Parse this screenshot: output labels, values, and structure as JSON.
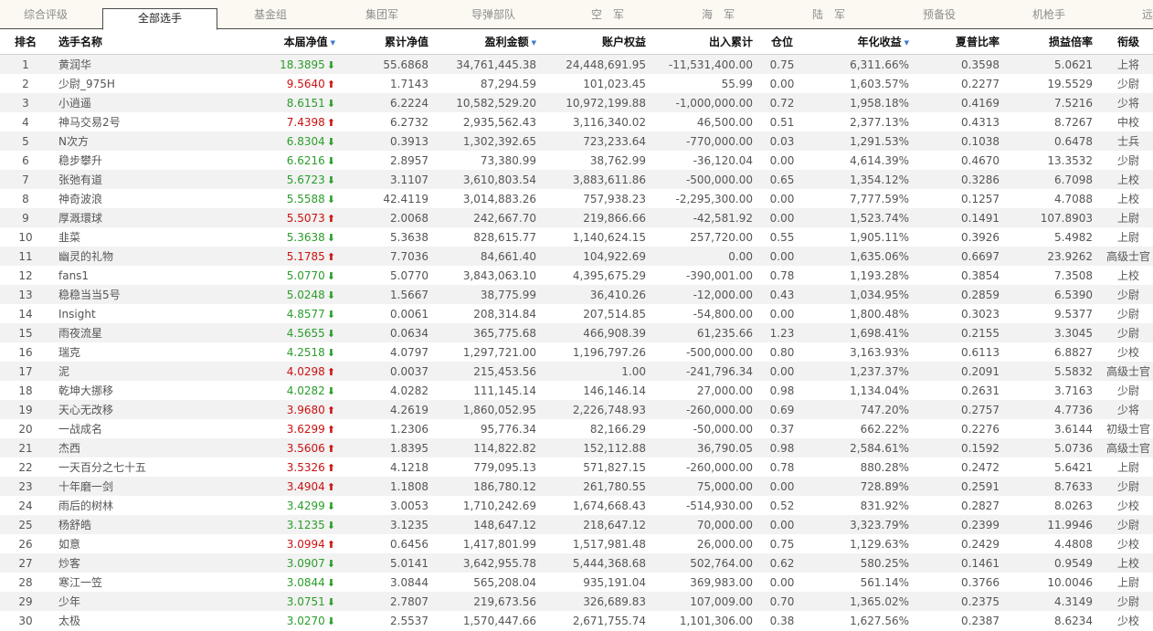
{
  "tabs": [
    "综合评级",
    "全部选手",
    "基金组",
    "集团军",
    "导弹部队",
    "空　军",
    "海　军",
    "陆　军",
    "预备役",
    "机枪手",
    "远"
  ],
  "active_tab": 1,
  "columns": [
    "排名",
    "选手名称",
    "本届净值",
    "累计净值",
    "盈利金额",
    "账户权益",
    "出入累计",
    "仓位",
    "年化收益",
    "夏普比率",
    "损益倍率",
    "衔级"
  ],
  "sorted_columns": [
    "本届净值",
    "盈利金额",
    "年化收益"
  ],
  "colors": {
    "up": "#cc1111",
    "down": "#2a9d2a",
    "sort_indicator": "#3a78c9"
  },
  "rows": [
    {
      "rank": "1",
      "name": "黄润华",
      "nav": "18.3895",
      "trend": "down",
      "cum": "55.6868",
      "profit": "34,761,445.38",
      "equity": "24,448,691.95",
      "flow": "-11,531,400.00",
      "pos": "0.75",
      "annual": "6,311.66%",
      "sharpe": "0.3598",
      "ratio": "5.0621",
      "title": "上将"
    },
    {
      "rank": "2",
      "name": "少尉_975H",
      "nav": "9.5640",
      "trend": "up",
      "cum": "1.7143",
      "profit": "87,294.59",
      "equity": "101,023.45",
      "flow": "55.99",
      "pos": "0.00",
      "annual": "1,603.57%",
      "sharpe": "0.2277",
      "ratio": "19.5529",
      "title": "少尉"
    },
    {
      "rank": "3",
      "name": "小逍遥",
      "nav": "8.6151",
      "trend": "down",
      "cum": "6.2224",
      "profit": "10,582,529.20",
      "equity": "10,972,199.88",
      "flow": "-1,000,000.00",
      "pos": "0.72",
      "annual": "1,958.18%",
      "sharpe": "0.4169",
      "ratio": "7.5216",
      "title": "少将"
    },
    {
      "rank": "4",
      "name": "神马交易2号",
      "nav": "7.4398",
      "trend": "up",
      "cum": "6.2732",
      "profit": "2,935,562.43",
      "equity": "3,116,340.02",
      "flow": "46,500.00",
      "pos": "0.51",
      "annual": "2,377.13%",
      "sharpe": "0.4313",
      "ratio": "8.7267",
      "title": "中校"
    },
    {
      "rank": "5",
      "name": "N次方",
      "nav": "6.8304",
      "trend": "down",
      "cum": "0.3913",
      "profit": "1,302,392.65",
      "equity": "723,233.64",
      "flow": "-770,000.00",
      "pos": "0.03",
      "annual": "1,291.53%",
      "sharpe": "0.1038",
      "ratio": "0.6478",
      "title": "士兵"
    },
    {
      "rank": "6",
      "name": "稳步攀升",
      "nav": "6.6216",
      "trend": "down",
      "cum": "2.8957",
      "profit": "73,380.99",
      "equity": "38,762.99",
      "flow": "-36,120.04",
      "pos": "0.00",
      "annual": "4,614.39%",
      "sharpe": "0.4670",
      "ratio": "13.3532",
      "title": "少尉"
    },
    {
      "rank": "7",
      "name": "张弛有道",
      "nav": "5.6723",
      "trend": "down",
      "cum": "3.1107",
      "profit": "3,610,803.54",
      "equity": "3,883,611.86",
      "flow": "-500,000.00",
      "pos": "0.65",
      "annual": "1,354.12%",
      "sharpe": "0.3286",
      "ratio": "6.7098",
      "title": "上校"
    },
    {
      "rank": "8",
      "name": "神奇波浪",
      "nav": "5.5588",
      "trend": "down",
      "cum": "42.4119",
      "profit": "3,014,883.26",
      "equity": "757,938.23",
      "flow": "-2,295,300.00",
      "pos": "0.00",
      "annual": "7,777.59%",
      "sharpe": "0.1257",
      "ratio": "4.7088",
      "title": "上校"
    },
    {
      "rank": "9",
      "name": "厚溉環球",
      "nav": "5.5073",
      "trend": "up",
      "cum": "2.0068",
      "profit": "242,667.70",
      "equity": "219,866.66",
      "flow": "-42,581.92",
      "pos": "0.00",
      "annual": "1,523.74%",
      "sharpe": "0.1491",
      "ratio": "107.8903",
      "title": "上尉"
    },
    {
      "rank": "10",
      "name": "韭菜",
      "nav": "5.3638",
      "trend": "down",
      "cum": "5.3638",
      "profit": "828,615.77",
      "equity": "1,140,624.15",
      "flow": "257,720.00",
      "pos": "0.55",
      "annual": "1,905.11%",
      "sharpe": "0.3926",
      "ratio": "5.4982",
      "title": "上尉"
    },
    {
      "rank": "11",
      "name": "幽灵的礼物",
      "nav": "5.1785",
      "trend": "up",
      "cum": "7.7036",
      "profit": "84,661.40",
      "equity": "104,922.69",
      "flow": "0.00",
      "pos": "0.00",
      "annual": "1,635.06%",
      "sharpe": "0.6697",
      "ratio": "23.9262",
      "title": "高级士官"
    },
    {
      "rank": "12",
      "name": "fans1",
      "nav": "5.0770",
      "trend": "down",
      "cum": "5.0770",
      "profit": "3,843,063.10",
      "equity": "4,395,675.29",
      "flow": "-390,001.00",
      "pos": "0.78",
      "annual": "1,193.28%",
      "sharpe": "0.3854",
      "ratio": "7.3508",
      "title": "上校"
    },
    {
      "rank": "13",
      "name": "稳稳当当5号",
      "nav": "5.0248",
      "trend": "down",
      "cum": "1.5667",
      "profit": "38,775.99",
      "equity": "36,410.26",
      "flow": "-12,000.00",
      "pos": "0.43",
      "annual": "1,034.95%",
      "sharpe": "0.2859",
      "ratio": "6.5390",
      "title": "少尉"
    },
    {
      "rank": "14",
      "name": "Insight",
      "nav": "4.8577",
      "trend": "down",
      "cum": "0.0061",
      "profit": "208,314.84",
      "equity": "207,514.85",
      "flow": "-54,800.00",
      "pos": "0.00",
      "annual": "1,800.48%",
      "sharpe": "0.3023",
      "ratio": "9.5377",
      "title": "少尉"
    },
    {
      "rank": "15",
      "name": "雨夜流星",
      "nav": "4.5655",
      "trend": "down",
      "cum": "0.0634",
      "profit": "365,775.68",
      "equity": "466,908.39",
      "flow": "61,235.66",
      "pos": "1.23",
      "annual": "1,698.41%",
      "sharpe": "0.2155",
      "ratio": "3.3045",
      "title": "少尉"
    },
    {
      "rank": "16",
      "name": "瑞克",
      "nav": "4.2518",
      "trend": "down",
      "cum": "4.0797",
      "profit": "1,297,721.00",
      "equity": "1,196,797.26",
      "flow": "-500,000.00",
      "pos": "0.80",
      "annual": "3,163.93%",
      "sharpe": "0.6113",
      "ratio": "6.8827",
      "title": "少校"
    },
    {
      "rank": "17",
      "name": "泥",
      "nav": "4.0298",
      "trend": "up",
      "cum": "0.0037",
      "profit": "215,453.56",
      "equity": "1.00",
      "flow": "-241,796.34",
      "pos": "0.00",
      "annual": "1,237.37%",
      "sharpe": "0.2091",
      "ratio": "5.5832",
      "title": "高级士官"
    },
    {
      "rank": "18",
      "name": "乾坤大挪移",
      "nav": "4.0282",
      "trend": "down",
      "cum": "4.0282",
      "profit": "111,145.14",
      "equity": "146,146.14",
      "flow": "27,000.00",
      "pos": "0.98",
      "annual": "1,134.04%",
      "sharpe": "0.2631",
      "ratio": "3.7163",
      "title": "少尉"
    },
    {
      "rank": "19",
      "name": "天心无改移",
      "nav": "3.9680",
      "trend": "up",
      "cum": "4.2619",
      "profit": "1,860,052.95",
      "equity": "2,226,748.93",
      "flow": "-260,000.00",
      "pos": "0.69",
      "annual": "747.20%",
      "sharpe": "0.2757",
      "ratio": "4.7736",
      "title": "少将"
    },
    {
      "rank": "20",
      "name": "一战成名",
      "nav": "3.6299",
      "trend": "up",
      "cum": "1.2306",
      "profit": "95,776.34",
      "equity": "82,166.29",
      "flow": "-50,000.00",
      "pos": "0.37",
      "annual": "662.22%",
      "sharpe": "0.2276",
      "ratio": "3.6144",
      "title": "初级士官"
    },
    {
      "rank": "21",
      "name": "杰西",
      "nav": "3.5606",
      "trend": "up",
      "cum": "1.8395",
      "profit": "114,822.82",
      "equity": "152,112.88",
      "flow": "36,790.05",
      "pos": "0.98",
      "annual": "2,584.61%",
      "sharpe": "0.1592",
      "ratio": "5.0736",
      "title": "高级士官"
    },
    {
      "rank": "22",
      "name": "一天百分之七十五",
      "nav": "3.5326",
      "trend": "up",
      "cum": "4.1218",
      "profit": "779,095.13",
      "equity": "571,827.15",
      "flow": "-260,000.00",
      "pos": "0.78",
      "annual": "880.28%",
      "sharpe": "0.2472",
      "ratio": "5.6421",
      "title": "上尉"
    },
    {
      "rank": "23",
      "name": "十年磨一剑",
      "nav": "3.4904",
      "trend": "up",
      "cum": "1.1808",
      "profit": "186,780.12",
      "equity": "261,780.55",
      "flow": "75,000.00",
      "pos": "0.00",
      "annual": "728.89%",
      "sharpe": "0.2591",
      "ratio": "8.7633",
      "title": "少尉"
    },
    {
      "rank": "24",
      "name": "雨后的树林",
      "nav": "3.4299",
      "trend": "down",
      "cum": "3.0053",
      "profit": "1,710,242.69",
      "equity": "1,674,668.43",
      "flow": "-514,930.00",
      "pos": "0.52",
      "annual": "831.92%",
      "sharpe": "0.2827",
      "ratio": "8.0263",
      "title": "少校"
    },
    {
      "rank": "25",
      "name": "杨舒皓",
      "nav": "3.1235",
      "trend": "down",
      "cum": "3.1235",
      "profit": "148,647.12",
      "equity": "218,647.12",
      "flow": "70,000.00",
      "pos": "0.00",
      "annual": "3,323.79%",
      "sharpe": "0.2399",
      "ratio": "11.9946",
      "title": "少尉"
    },
    {
      "rank": "26",
      "name": "如意",
      "nav": "3.0994",
      "trend": "up",
      "cum": "0.6456",
      "profit": "1,417,801.99",
      "equity": "1,517,981.48",
      "flow": "26,000.00",
      "pos": "0.75",
      "annual": "1,129.63%",
      "sharpe": "0.2429",
      "ratio": "4.4808",
      "title": "少校"
    },
    {
      "rank": "27",
      "name": "炒客",
      "nav": "3.0907",
      "trend": "down",
      "cum": "5.0141",
      "profit": "3,642,955.78",
      "equity": "5,444,368.68",
      "flow": "502,764.00",
      "pos": "0.62",
      "annual": "580.25%",
      "sharpe": "0.1461",
      "ratio": "0.9549",
      "title": "上校"
    },
    {
      "rank": "28",
      "name": "寒江一笠",
      "nav": "3.0844",
      "trend": "down",
      "cum": "3.0844",
      "profit": "565,208.04",
      "equity": "935,191.04",
      "flow": "369,983.00",
      "pos": "0.00",
      "annual": "561.14%",
      "sharpe": "0.3766",
      "ratio": "10.0046",
      "title": "上尉"
    },
    {
      "rank": "29",
      "name": "少年",
      "nav": "3.0751",
      "trend": "down",
      "cum": "2.7807",
      "profit": "219,673.56",
      "equity": "326,689.83",
      "flow": "107,009.00",
      "pos": "0.70",
      "annual": "1,365.02%",
      "sharpe": "0.2375",
      "ratio": "4.3149",
      "title": "少尉"
    },
    {
      "rank": "30",
      "name": "太极",
      "nav": "3.0270",
      "trend": "down",
      "cum": "2.5537",
      "profit": "1,570,447.66",
      "equity": "2,671,755.74",
      "flow": "1,101,306.00",
      "pos": "0.38",
      "annual": "1,627.56%",
      "sharpe": "0.2387",
      "ratio": "8.6234",
      "title": "少校"
    }
  ]
}
